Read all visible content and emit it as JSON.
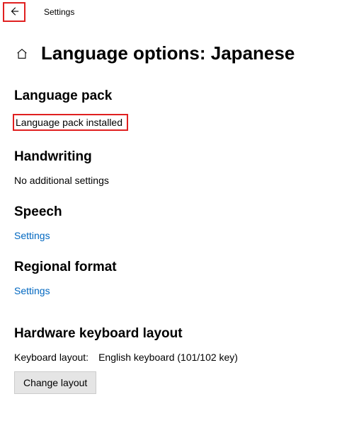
{
  "topbar": {
    "app_label": "Settings"
  },
  "header": {
    "title": "Language options: Japanese"
  },
  "sections": {
    "language_pack": {
      "heading": "Language pack",
      "status": "Language pack installed"
    },
    "handwriting": {
      "heading": "Handwriting",
      "status": "No additional settings"
    },
    "speech": {
      "heading": "Speech",
      "link": "Settings"
    },
    "regional_format": {
      "heading": "Regional format",
      "link": "Settings"
    },
    "hardware_keyboard": {
      "heading": "Hardware keyboard layout",
      "label": "Keyboard layout:",
      "value": "English keyboard (101/102 key)",
      "button": "Change layout"
    }
  }
}
